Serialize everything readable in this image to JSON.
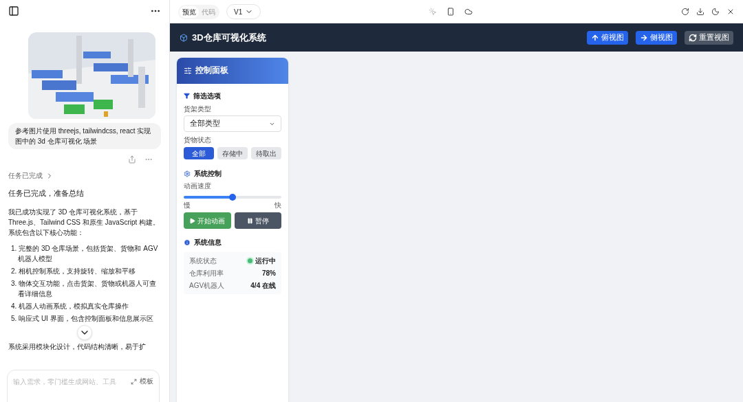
{
  "chat": {
    "user_message": "参考图片使用 threejs, tailwindcss, react 实现图中的 3d 仓库可视化 场景",
    "task_status": "任务已完成",
    "status_line": "任务已完成，准备总结",
    "intro": "我已成功实现了 3D 仓库可视化系统，基于 Three.js、Tailwind CSS 和原生 JavaScript 构建。系统包含以下核心功能：",
    "features": [
      "1. 完整的 3D 仓库场景，包括货架、货物和 AGV 机器人模型",
      "2. 相机控制系统，支持旋转、缩放和平移",
      "3. 物体交互功能，点击货架、货物或机器人可查看详细信息",
      "4. 机器人动画系统，模拟真实仓库操作",
      "5. 响应式 UI 界面，包含控制面板和信息展示区"
    ],
    "closing": "系统采用模块化设计，代码结构清晰，易于扩",
    "input": {
      "placeholder": "输入需求，零门槛生成网站、工具"
    },
    "template_button": "模板"
  },
  "preview": {
    "tabs": [
      {
        "label": "预览",
        "selected": true
      },
      {
        "label": "代码",
        "selected": false
      }
    ],
    "version": "V1",
    "app": {
      "title": "3D仓库可视化系统",
      "view_buttons": [
        {
          "label": "俯视图",
          "kind": "top"
        },
        {
          "label": "侧视图",
          "kind": "side"
        },
        {
          "label": "重置视图",
          "kind": "reset"
        }
      ],
      "panel": {
        "title": "控制面板",
        "filter": {
          "title": "筛选选项",
          "shelf_label": "货架类型",
          "shelf_value": "全部类型",
          "status_label": "货物状态",
          "status_options": [
            {
              "label": "全部",
              "selected": true
            },
            {
              "label": "存储中",
              "selected": false
            },
            {
              "label": "待取出",
              "selected": false
            }
          ]
        },
        "control": {
          "title": "系统控制",
          "speed_label": "动画速度",
          "speed": {
            "level": 0.5
          },
          "slow": "慢",
          "fast": "快",
          "buttons": [
            {
              "label": "开始动画",
              "kind": "play"
            },
            {
              "label": "暂停",
              "kind": "pause"
            }
          ]
        },
        "info": {
          "title": "系统信息",
          "rows": [
            {
              "label": "系统状态",
              "value": "运行中",
              "kind": "status",
              "color": "#48bb78"
            },
            {
              "label": "仓库利用率",
              "value": "78%",
              "kind": "text"
            },
            {
              "label": "AGV机器人",
              "value": "4/4 在线",
              "kind": "text"
            }
          ]
        }
      }
    }
  }
}
